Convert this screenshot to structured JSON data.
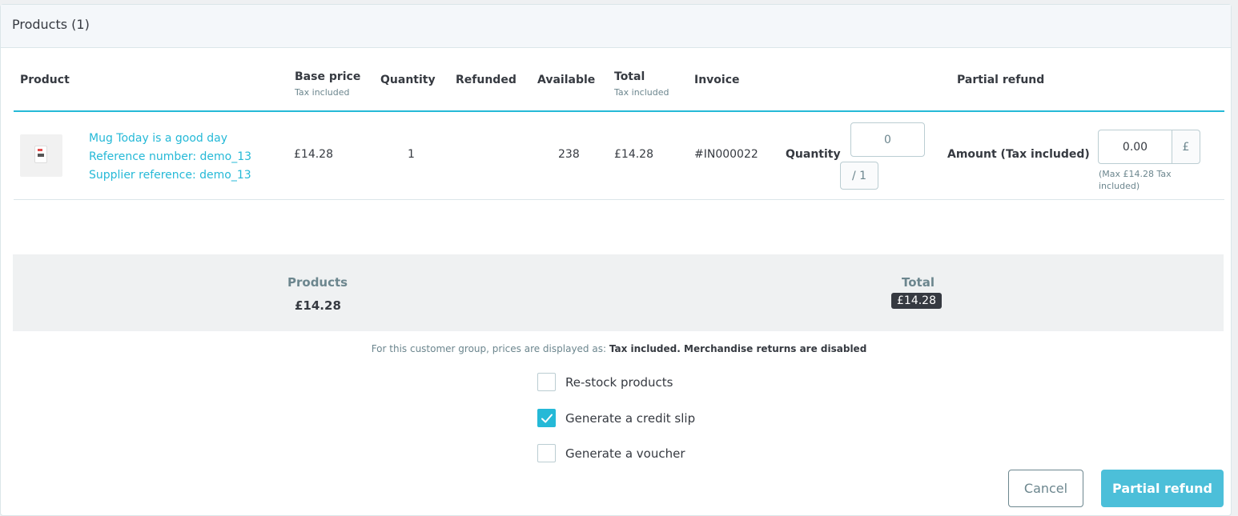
{
  "card": {
    "title": "Products (1)"
  },
  "table": {
    "headers": {
      "product": "Product",
      "base_price": "Base price",
      "base_price_sub": "Tax included",
      "quantity": "Quantity",
      "refunded": "Refunded",
      "available": "Available",
      "total": "Total",
      "total_sub": "Tax included",
      "invoice": "Invoice",
      "partial_refund": "Partial refund"
    },
    "row": {
      "name": "Mug Today is a good day",
      "reference": "Reference number: demo_13",
      "supplier_reference": "Supplier reference: demo_13",
      "base_price": "£14.28",
      "quantity": "1",
      "refunded": "",
      "available": "238",
      "total": "£14.28",
      "invoice": "#IN000022",
      "refund_qty_label": "Quantity",
      "refund_qty_value": "0",
      "refund_qty_max": "/ 1",
      "refund_amount_label": "Amount (Tax included)",
      "refund_amount_value": "0.00",
      "currency": "£",
      "max_help_line1": "(Max £14.28 Tax",
      "max_help_line2": "included)"
    }
  },
  "totals": {
    "products_label": "Products",
    "products_value": "£14.28",
    "total_label": "Total",
    "total_value": "£14.28"
  },
  "note": {
    "prefix": "For this customer group, prices are displayed as:",
    "tax_mode": "Tax included",
    "returns": "Merchandise returns are disabled"
  },
  "options": [
    {
      "label": "Re-stock products",
      "checked": false
    },
    {
      "label": "Generate a credit slip",
      "checked": true
    },
    {
      "label": "Generate a voucher",
      "checked": false
    }
  ],
  "actions": {
    "cancel": "Cancel",
    "partial_refund": "Partial refund"
  },
  "colors": {
    "accent": "#25b9d7",
    "primary_button": "#4cbfd9",
    "badge_bg": "#363a41",
    "muted_text": "#6c868e"
  }
}
